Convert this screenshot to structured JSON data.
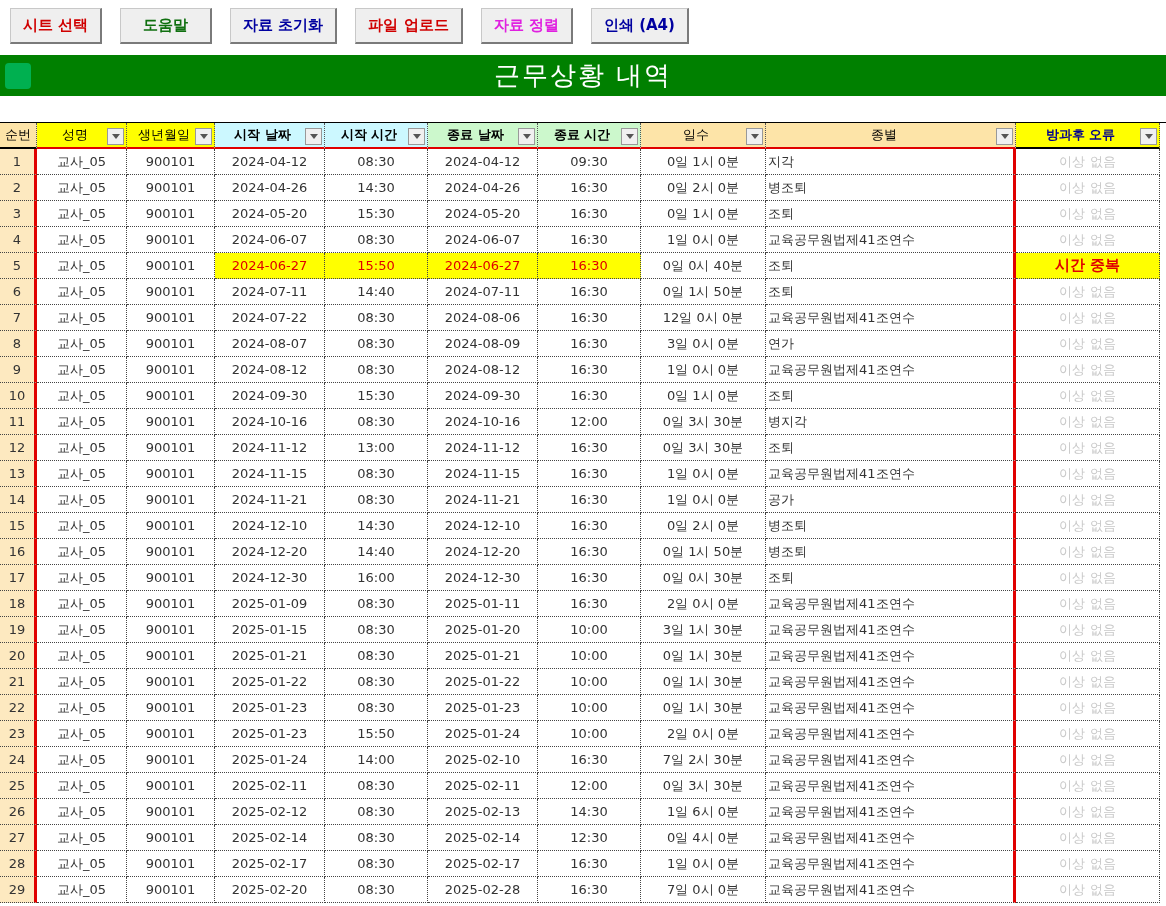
{
  "toolbar": [
    {
      "label": "시트 선택",
      "color": "#d00000"
    },
    {
      "label": "도움말",
      "color": "#107010"
    },
    {
      "label": "자료 초기화",
      "color": "#0000a0"
    },
    {
      "label": "파일 업로드",
      "color": "#d00000"
    },
    {
      "label": "자료 정렬",
      "color": "#e020e0"
    },
    {
      "label": "인쇄 (A4)",
      "color": "#0000a0"
    }
  ],
  "title": "근무상황 내역",
  "table": {
    "columns": [
      {
        "label": "순번",
        "filter": false
      },
      {
        "label": "성명",
        "filter": true
      },
      {
        "label": "생년월일",
        "filter": true
      },
      {
        "label": "시작 날짜",
        "filter": true
      },
      {
        "label": "시작 시간",
        "filter": true
      },
      {
        "label": "종료 날짜",
        "filter": true
      },
      {
        "label": "종료 시간",
        "filter": true
      },
      {
        "label": "일수",
        "filter": true
      },
      {
        "label": "종별",
        "filter": true
      },
      {
        "label": "방과후 오류",
        "filter": true
      }
    ],
    "rows": [
      {
        "cells": [
          "1",
          "교사_05",
          "900101",
          "2024-04-12",
          "08:30",
          "2024-04-12",
          "09:30",
          "0일 1시 0분",
          "지각",
          "이상 없음"
        ],
        "flagged": false
      },
      {
        "cells": [
          "2",
          "교사_05",
          "900101",
          "2024-04-26",
          "14:30",
          "2024-04-26",
          "16:30",
          "0일 2시 0분",
          "병조퇴",
          "이상 없음"
        ],
        "flagged": false
      },
      {
        "cells": [
          "3",
          "교사_05",
          "900101",
          "2024-05-20",
          "15:30",
          "2024-05-20",
          "16:30",
          "0일 1시 0분",
          "조퇴",
          "이상 없음"
        ],
        "flagged": false
      },
      {
        "cells": [
          "4",
          "교사_05",
          "900101",
          "2024-06-07",
          "08:30",
          "2024-06-07",
          "16:30",
          "1일 0시 0분",
          "교육공무원법제41조연수",
          "이상 없음"
        ],
        "flagged": false
      },
      {
        "cells": [
          "5",
          "교사_05",
          "900101",
          "2024-06-27",
          "15:50",
          "2024-06-27",
          "16:30",
          "0일 0시 40분",
          "조퇴",
          "시간 중복"
        ],
        "flagged": true
      },
      {
        "cells": [
          "6",
          "교사_05",
          "900101",
          "2024-07-11",
          "14:40",
          "2024-07-11",
          "16:30",
          "0일 1시 50분",
          "조퇴",
          "이상 없음"
        ],
        "flagged": false
      },
      {
        "cells": [
          "7",
          "교사_05",
          "900101",
          "2024-07-22",
          "08:30",
          "2024-08-06",
          "16:30",
          "12일 0시 0분",
          "교육공무원법제41조연수",
          "이상 없음"
        ],
        "flagged": false
      },
      {
        "cells": [
          "8",
          "교사_05",
          "900101",
          "2024-08-07",
          "08:30",
          "2024-08-09",
          "16:30",
          "3일 0시 0분",
          "연가",
          "이상 없음"
        ],
        "flagged": false
      },
      {
        "cells": [
          "9",
          "교사_05",
          "900101",
          "2024-08-12",
          "08:30",
          "2024-08-12",
          "16:30",
          "1일 0시 0분",
          "교육공무원법제41조연수",
          "이상 없음"
        ],
        "flagged": false
      },
      {
        "cells": [
          "10",
          "교사_05",
          "900101",
          "2024-09-30",
          "15:30",
          "2024-09-30",
          "16:30",
          "0일 1시 0분",
          "조퇴",
          "이상 없음"
        ],
        "flagged": false
      },
      {
        "cells": [
          "11",
          "교사_05",
          "900101",
          "2024-10-16",
          "08:30",
          "2024-10-16",
          "12:00",
          "0일 3시 30분",
          "병지각",
          "이상 없음"
        ],
        "flagged": false
      },
      {
        "cells": [
          "12",
          "교사_05",
          "900101",
          "2024-11-12",
          "13:00",
          "2024-11-12",
          "16:30",
          "0일 3시 30분",
          "조퇴",
          "이상 없음"
        ],
        "flagged": false
      },
      {
        "cells": [
          "13",
          "교사_05",
          "900101",
          "2024-11-15",
          "08:30",
          "2024-11-15",
          "16:30",
          "1일 0시 0분",
          "교육공무원법제41조연수",
          "이상 없음"
        ],
        "flagged": false
      },
      {
        "cells": [
          "14",
          "교사_05",
          "900101",
          "2024-11-21",
          "08:30",
          "2024-11-21",
          "16:30",
          "1일 0시 0분",
          "공가",
          "이상 없음"
        ],
        "flagged": false
      },
      {
        "cells": [
          "15",
          "교사_05",
          "900101",
          "2024-12-10",
          "14:30",
          "2024-12-10",
          "16:30",
          "0일 2시 0분",
          "병조퇴",
          "이상 없음"
        ],
        "flagged": false
      },
      {
        "cells": [
          "16",
          "교사_05",
          "900101",
          "2024-12-20",
          "14:40",
          "2024-12-20",
          "16:30",
          "0일 1시 50분",
          "병조퇴",
          "이상 없음"
        ],
        "flagged": false
      },
      {
        "cells": [
          "17",
          "교사_05",
          "900101",
          "2024-12-30",
          "16:00",
          "2024-12-30",
          "16:30",
          "0일 0시 30분",
          "조퇴",
          "이상 없음"
        ],
        "flagged": false
      },
      {
        "cells": [
          "18",
          "교사_05",
          "900101",
          "2025-01-09",
          "08:30",
          "2025-01-11",
          "16:30",
          "2일 0시 0분",
          "교육공무원법제41조연수",
          "이상 없음"
        ],
        "flagged": false
      },
      {
        "cells": [
          "19",
          "교사_05",
          "900101",
          "2025-01-15",
          "08:30",
          "2025-01-20",
          "10:00",
          "3일 1시 30분",
          "교육공무원법제41조연수",
          "이상 없음"
        ],
        "flagged": false
      },
      {
        "cells": [
          "20",
          "교사_05",
          "900101",
          "2025-01-21",
          "08:30",
          "2025-01-21",
          "10:00",
          "0일 1시 30분",
          "교육공무원법제41조연수",
          "이상 없음"
        ],
        "flagged": false
      },
      {
        "cells": [
          "21",
          "교사_05",
          "900101",
          "2025-01-22",
          "08:30",
          "2025-01-22",
          "10:00",
          "0일 1시 30분",
          "교육공무원법제41조연수",
          "이상 없음"
        ],
        "flagged": false
      },
      {
        "cells": [
          "22",
          "교사_05",
          "900101",
          "2025-01-23",
          "08:30",
          "2025-01-23",
          "10:00",
          "0일 1시 30분",
          "교육공무원법제41조연수",
          "이상 없음"
        ],
        "flagged": false
      },
      {
        "cells": [
          "23",
          "교사_05",
          "900101",
          "2025-01-23",
          "15:50",
          "2025-01-24",
          "10:00",
          "2일 0시 0분",
          "교육공무원법제41조연수",
          "이상 없음"
        ],
        "flagged": false
      },
      {
        "cells": [
          "24",
          "교사_05",
          "900101",
          "2025-01-24",
          "14:00",
          "2025-02-10",
          "16:30",
          "7일 2시 30분",
          "교육공무원법제41조연수",
          "이상 없음"
        ],
        "flagged": false
      },
      {
        "cells": [
          "25",
          "교사_05",
          "900101",
          "2025-02-11",
          "08:30",
          "2025-02-11",
          "12:00",
          "0일 3시 30분",
          "교육공무원법제41조연수",
          "이상 없음"
        ],
        "flagged": false
      },
      {
        "cells": [
          "26",
          "교사_05",
          "900101",
          "2025-02-12",
          "08:30",
          "2025-02-13",
          "14:30",
          "1일 6시 0분",
          "교육공무원법제41조연수",
          "이상 없음"
        ],
        "flagged": false
      },
      {
        "cells": [
          "27",
          "교사_05",
          "900101",
          "2025-02-14",
          "08:30",
          "2025-02-14",
          "12:30",
          "0일 4시 0분",
          "교육공무원법제41조연수",
          "이상 없음"
        ],
        "flagged": false
      },
      {
        "cells": [
          "28",
          "교사_05",
          "900101",
          "2025-02-17",
          "08:30",
          "2025-02-17",
          "16:30",
          "1일 0시 0분",
          "교육공무원법제41조연수",
          "이상 없음"
        ],
        "flagged": false
      },
      {
        "cells": [
          "29",
          "교사_05",
          "900101",
          "2025-02-20",
          "08:30",
          "2025-02-28",
          "16:30",
          "7일 0시 0분",
          "교육공무원법제41조연수",
          "이상 없음"
        ],
        "flagged": false
      }
    ]
  }
}
